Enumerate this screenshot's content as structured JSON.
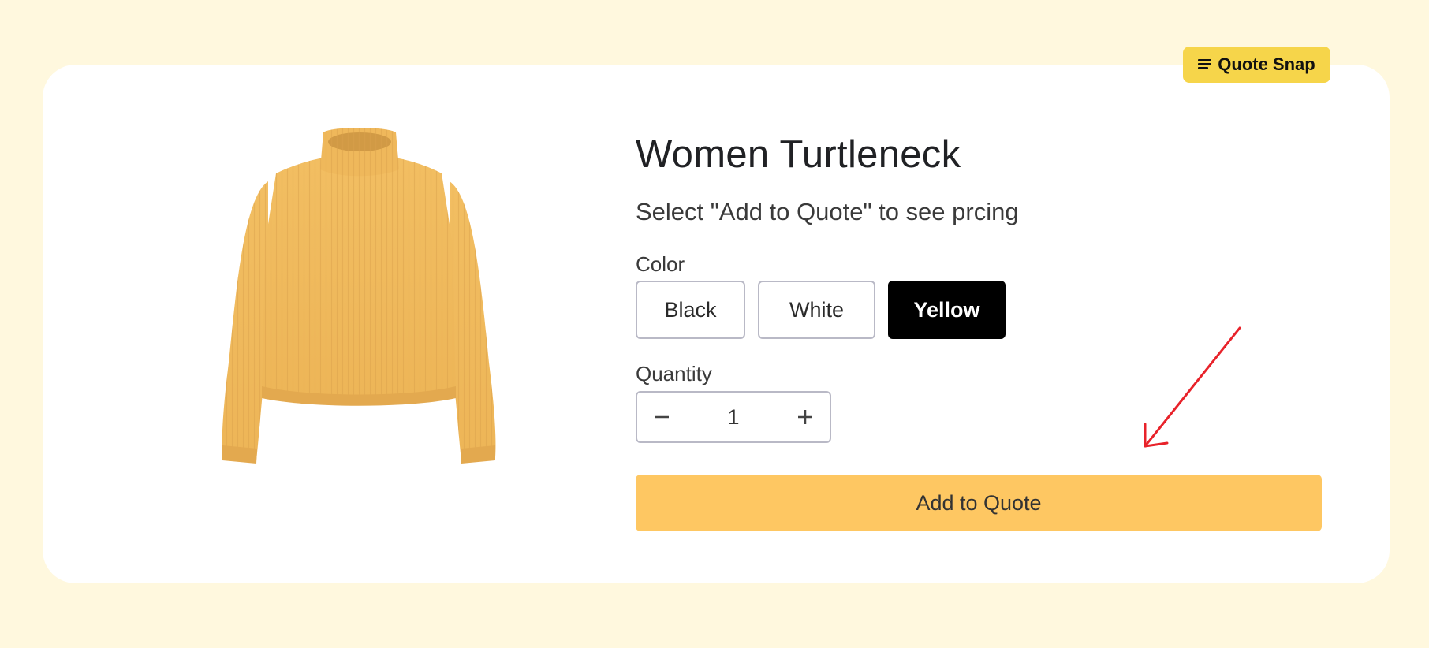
{
  "brand": {
    "badge_label": "Quote Snap",
    "badge_icon": "list-icon",
    "badge_color": "#F6D54A"
  },
  "product": {
    "title": "Women Turtleneck",
    "subtitle": "Select \"Add to Quote\" to see prcing",
    "image_icon": "sweater-image",
    "image_color": "#F0B95C"
  },
  "color_option": {
    "label": "Color",
    "options": [
      "Black",
      "White",
      "Yellow"
    ],
    "selected": "Yellow"
  },
  "quantity": {
    "label": "Quantity",
    "value": "1",
    "decrement_icon": "minus-icon",
    "increment_icon": "plus-icon"
  },
  "cta": {
    "label": "Add to Quote",
    "color": "#FEC762"
  },
  "annotation": {
    "arrow_icon": "arrow-pointer-icon",
    "arrow_color": "#E8222A"
  },
  "colors": {
    "page_background": "#FFF8DE",
    "card_background": "#FFFFFF",
    "selected_option_bg": "#000000"
  }
}
